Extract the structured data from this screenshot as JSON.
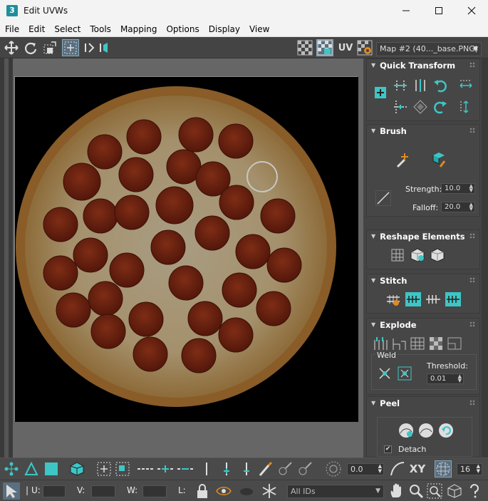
{
  "window": {
    "title": "Edit UVWs",
    "app_icon": "3"
  },
  "menu": [
    "File",
    "Edit",
    "Select",
    "Tools",
    "Mapping",
    "Options",
    "Display",
    "View"
  ],
  "toolbar": {
    "uv_label": "UV",
    "map_dropdown": "Map #2 (40..._base.PNG)"
  },
  "rollouts": {
    "quick_transform": "Quick Transform",
    "brush": {
      "title": "Brush",
      "strength_label": "Strength:",
      "strength_value": "10.0",
      "falloff_label": "Falloff:",
      "falloff_value": "20.0"
    },
    "reshape": "Reshape Elements",
    "stitch": "Stitch",
    "explode": {
      "title": "Explode",
      "weld_label": "Weld",
      "threshold_label": "Threshold:",
      "threshold_value": "0.01"
    },
    "peel": {
      "title": "Peel",
      "detach_label": "Detach"
    }
  },
  "bottom": {
    "angle_value": "0.0",
    "xy_label": "XY",
    "grid_value": "16",
    "u_label": "U:",
    "v_label": "V:",
    "w_label": "W:",
    "l_label": "L:",
    "ids_dropdown": "All IDs"
  },
  "colors": {
    "accent": "#3ec6c6",
    "panel_bg": "#444444",
    "titlebar_bg": "#f3f3f3"
  }
}
